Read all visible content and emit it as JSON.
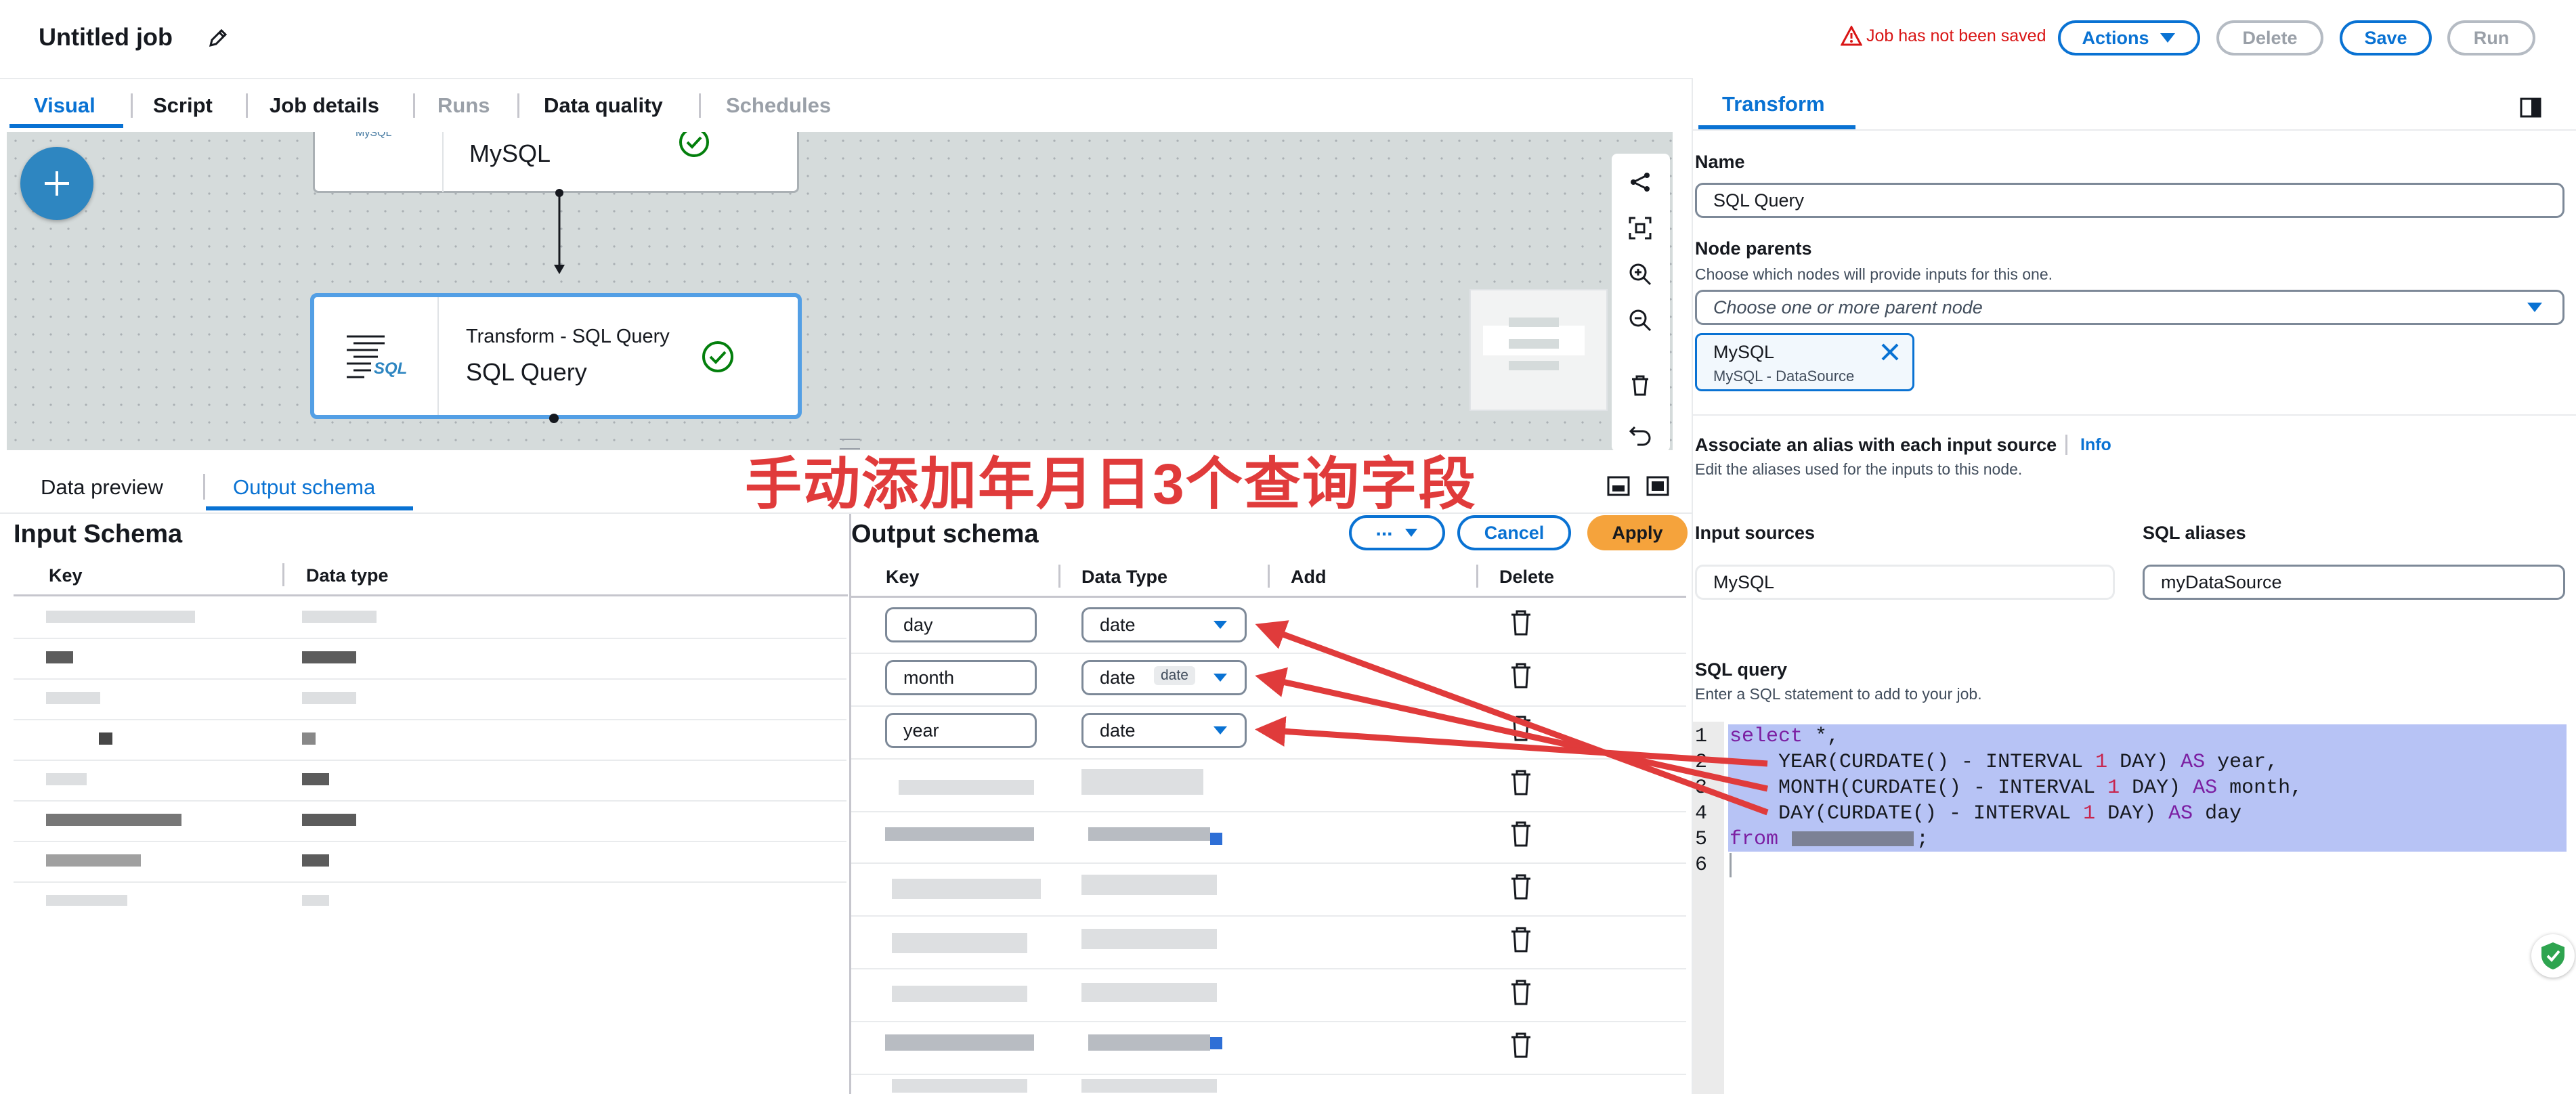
{
  "header": {
    "title": "Untitled job",
    "warning": "Job has not been saved",
    "actions_label": "Actions",
    "delete_label": "Delete",
    "save_label": "Save",
    "run_label": "Run"
  },
  "tabs": [
    "Visual",
    "Script",
    "Job details",
    "Runs",
    "Data quality",
    "Schedules"
  ],
  "canvas": {
    "node1_title": "MySQL",
    "node1_logo": "MySQL",
    "node2_subtitle": "Transform - SQL Query",
    "node2_title": "SQL Query",
    "node2_icon_text": "SQL"
  },
  "bottom_tabs": [
    "Data preview",
    "Output schema"
  ],
  "annotation": "手动添加年月日3个查询字段",
  "input_schema": {
    "title": "Input Schema",
    "col_key": "Key",
    "col_type": "Data type"
  },
  "output_schema": {
    "title": "Output schema",
    "more_label": "...",
    "cancel_label": "Cancel",
    "apply_label": "Apply",
    "col_key": "Key",
    "col_type": "Data Type",
    "col_add": "Add",
    "col_delete": "Delete",
    "rows": [
      {
        "key": "day",
        "type": "date"
      },
      {
        "key": "month",
        "type": "date",
        "tooltip": "date"
      },
      {
        "key": "year",
        "type": "date"
      }
    ]
  },
  "panel": {
    "tab": "Transform",
    "name_label": "Name",
    "name_value": "SQL Query",
    "parents_label": "Node parents",
    "parents_desc": "Choose which nodes will provide inputs for this one.",
    "parents_placeholder": "Choose one or more parent node",
    "token_title": "MySQL",
    "token_sub": "MySQL - DataSource",
    "alias_label": "Associate an alias with each input source",
    "info_label": "Info",
    "alias_desc": "Edit the aliases used for the inputs to this node.",
    "input_sources_label": "Input sources",
    "sql_aliases_label": "SQL aliases",
    "input_source_value": "MySQL",
    "alias_value": "myDataSource",
    "sql_label": "SQL query",
    "sql_desc": "Enter a SQL statement to add to your job.",
    "line_numbers": [
      "1",
      "2",
      "3",
      "4",
      "5",
      "6"
    ],
    "code": {
      "l1a": "select",
      "l1b": " *,",
      "l2a": "    YEAR(CURDATE() - INTERVAL ",
      "l2n": "1",
      "l2b": " DAY) ",
      "l2k": "AS",
      "l2c": " year,",
      "l3a": "    MONTH(CURDATE() - INTERVAL ",
      "l3n": "1",
      "l3b": " DAY) ",
      "l3k": "AS",
      "l3c": " month,",
      "l4a": "    DAY(CURDATE() - INTERVAL ",
      "l4n": "1",
      "l4b": " DAY) ",
      "l4k": "AS",
      "l4c": " day",
      "l5a": "from",
      "l5b": ";"
    }
  },
  "colors": {
    "accent": "#0972d3",
    "warning": "#d91515",
    "success": "#037f0c",
    "apply": "#f5a33c",
    "annotation": "#e03b3b",
    "selection": "#b7c3f5"
  }
}
